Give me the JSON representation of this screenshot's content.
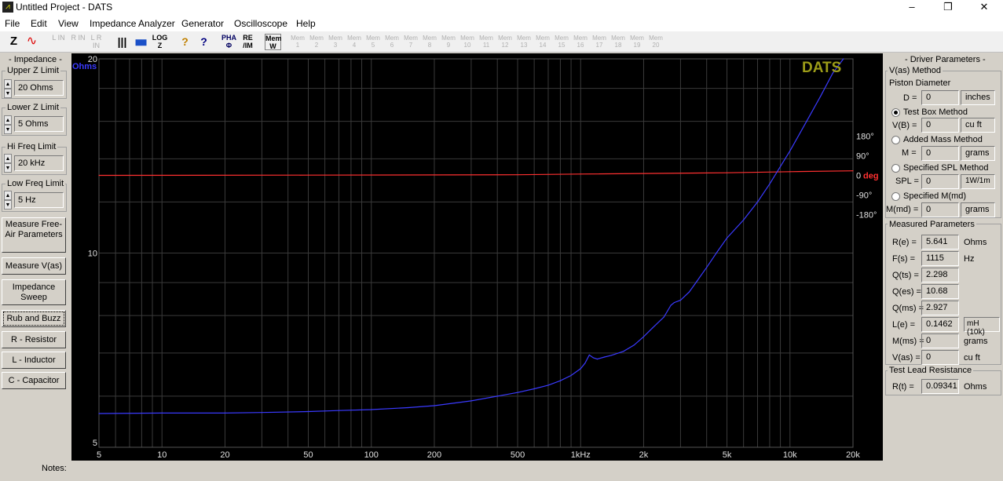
{
  "titlebar": {
    "title": "Untitled Project - DATS",
    "minimize": "–",
    "maximize": "❐",
    "close": "✕"
  },
  "menu": [
    "File",
    "Edit",
    "View",
    "Impedance Analyzer",
    "Generator",
    "Oscilloscope",
    "Help"
  ],
  "toolbar": {
    "items": [
      "Z",
      "∿",
      "L IN",
      "R IN",
      "L R IN",
      "|||",
      "▆▆",
      "LOG Z",
      "?",
      "?",
      "PHA Φ",
      "RE /IM",
      "Mem W"
    ],
    "mem": [
      "Mem 1",
      "Mem 2",
      "Mem 3",
      "Mem 4",
      "Mem 5",
      "Mem 6",
      "Mem 7",
      "Mem 8",
      "Mem 9",
      "Mem 10",
      "Mem 11",
      "Mem 12",
      "Mem 13",
      "Mem 14",
      "Mem 15",
      "Mem 16",
      "Mem 17",
      "Mem 18",
      "Mem 19",
      "Mem 20"
    ]
  },
  "left": {
    "group_title": "- Impedance -",
    "upper_z": {
      "label": "Upper Z Limit",
      "value": "20 Ohms"
    },
    "lower_z": {
      "label": "Lower Z Limit",
      "value": "5 Ohms"
    },
    "hi_freq": {
      "label": "Hi Freq Limit",
      "value": "20 kHz"
    },
    "low_freq": {
      "label": "Low Freq Limit",
      "value": "5 Hz"
    },
    "buttons": [
      "Measure Free-Air Parameters",
      "Measure V(as)",
      "Impedance Sweep",
      "Rub and Buzz",
      "R - Resistor",
      "L - Inductor",
      "C - Capacitor"
    ]
  },
  "plot": {
    "brand": "DATS",
    "left_unit": "Ohms",
    "phase_unit": "deg",
    "left_ticks": [
      "20",
      "10",
      "5"
    ],
    "right_ticks": [
      "180°",
      "90°",
      "0",
      "-90°",
      "-180°"
    ],
    "x_ticks": [
      "5",
      "10",
      "20",
      "50",
      "100",
      "200",
      "500",
      "1kHz",
      "2k",
      "5k",
      "10k",
      "20k"
    ],
    "colors": {
      "impedance": "#3a3aff",
      "phase": "#ff3030",
      "grid": "#3a3a3a",
      "brand": "#9c9c18"
    }
  },
  "chart_data": {
    "type": "line",
    "x_scale": "log",
    "xlim": [
      5,
      20000
    ],
    "y_scale": "log",
    "ylim": [
      5,
      20
    ],
    "y2lim": [
      -180,
      180
    ],
    "series": [
      {
        "name": "Ohms",
        "axis": "left",
        "x": [
          5,
          10,
          20,
          30,
          50,
          70,
          100,
          150,
          200,
          300,
          400,
          500,
          600,
          700,
          800,
          900,
          1000,
          1050,
          1100,
          1150,
          1200,
          1300,
          1400,
          1600,
          1800,
          2000,
          2200,
          2500,
          2700,
          2800,
          3000,
          3300,
          3600,
          4000,
          4500,
          5000,
          6000,
          7000,
          8000,
          10000,
          12000,
          14000,
          16000,
          18000
        ],
        "y": [
          5.64,
          5.65,
          5.65,
          5.66,
          5.68,
          5.7,
          5.72,
          5.76,
          5.8,
          5.9,
          6.0,
          6.08,
          6.16,
          6.24,
          6.34,
          6.46,
          6.62,
          6.75,
          6.95,
          6.88,
          6.85,
          6.9,
          6.94,
          7.04,
          7.2,
          7.42,
          7.65,
          7.96,
          8.3,
          8.38,
          8.45,
          8.7,
          9.05,
          9.5,
          10.05,
          10.55,
          11.25,
          12.0,
          12.8,
          14.4,
          16.0,
          17.5,
          19.0,
          20.0
        ]
      },
      {
        "name": "deg",
        "axis": "right",
        "x": [
          5,
          50,
          500,
          1000,
          5000,
          10000,
          20000
        ],
        "y": [
          0,
          1,
          3,
          6,
          12,
          17,
          21
        ]
      }
    ]
  },
  "right": {
    "group_title": "- Driver Parameters -",
    "vas_method": "V(as) Method",
    "piston": "Piston Diameter",
    "d": {
      "label": "D =",
      "value": "0",
      "unit": "inches"
    },
    "test_box": "Test Box Method",
    "vb": {
      "label": "V(B) =",
      "value": "0",
      "unit": "cu ft"
    },
    "added_mass": "Added Mass Method",
    "m": {
      "label": "M =",
      "value": "0",
      "unit": "grams"
    },
    "spec_spl": "Specified SPL Method",
    "spl": {
      "label": "SPL =",
      "value": "0",
      "unit": "1W/1m"
    },
    "spec_mmd": "Specified M(md)",
    "mmd": {
      "label": "M(md) =",
      "value": "0",
      "unit": "grams"
    },
    "measured_title": "Measured Parameters",
    "measured": [
      {
        "label": "R(e) =",
        "value": "5.641",
        "unit": "Ohms"
      },
      {
        "label": "F(s) =",
        "value": "1115",
        "unit": "Hz"
      },
      {
        "label": "Q(ts) =",
        "value": "2.298",
        "unit": ""
      },
      {
        "label": "Q(es) =",
        "value": "10.68",
        "unit": ""
      },
      {
        "label": "Q(ms) =",
        "value": "2.927",
        "unit": ""
      },
      {
        "label": "L(e) =",
        "value": "0.1462",
        "unit": "mH (10k)"
      },
      {
        "label": "M(ms) =",
        "value": "0",
        "unit": "grams"
      },
      {
        "label": "V(as) =",
        "value": "0",
        "unit": "cu ft"
      }
    ],
    "lead_title": "Test Lead Resistance",
    "rt": {
      "label": "R(t) =",
      "value": "0.09341",
      "unit": "Ohms"
    }
  },
  "notes": "Notes:"
}
